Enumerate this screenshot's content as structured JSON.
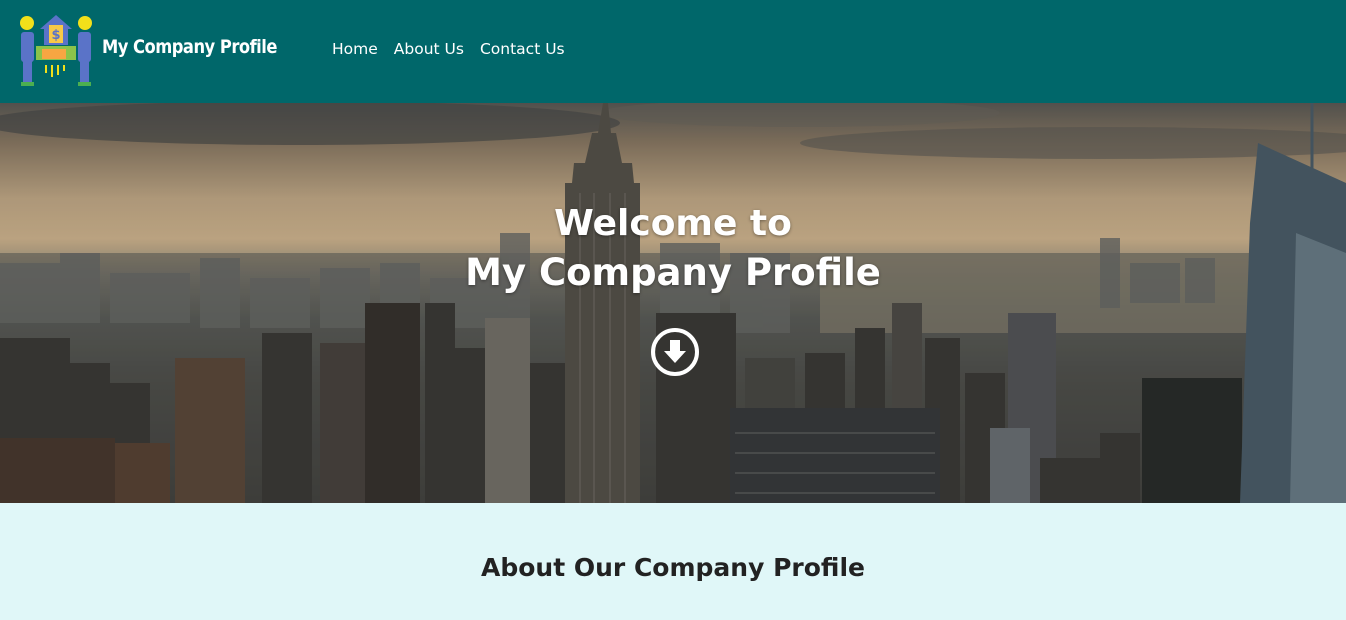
{
  "navbar": {
    "brand_name": "My Company Profile",
    "links": [
      {
        "label": "Home"
      },
      {
        "label": "About Us"
      },
      {
        "label": "Contact Us"
      }
    ],
    "background_color": "#00676a"
  },
  "hero": {
    "title_line1": "Welcome to",
    "title_line2": "My Company Profile",
    "scroll_icon": "arrow-down-circle-icon"
  },
  "about": {
    "heading": "About Our Company Profile",
    "background_color": "#e0f7f8"
  }
}
